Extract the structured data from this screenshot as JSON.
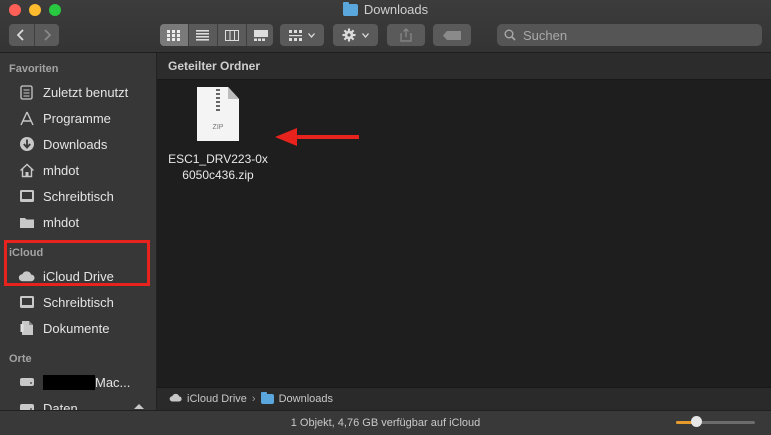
{
  "window": {
    "title": "Downloads"
  },
  "search": {
    "placeholder": "Suchen"
  },
  "sidebar": {
    "sections": [
      {
        "header": "Favoriten",
        "items": [
          {
            "label": "Zuletzt benutzt",
            "icon": "recents-icon"
          },
          {
            "label": "Programme",
            "icon": "applications-icon"
          },
          {
            "label": "Downloads",
            "icon": "downloads-icon"
          },
          {
            "label": "mhdot",
            "icon": "home-icon"
          },
          {
            "label": "Schreibtisch",
            "icon": "desktop-icon"
          },
          {
            "label": "mhdot",
            "icon": "folder-icon"
          }
        ]
      },
      {
        "header": "iCloud",
        "items": [
          {
            "label": "iCloud Drive",
            "icon": "cloud-icon"
          },
          {
            "label": "Schreibtisch",
            "icon": "desktop-icon"
          },
          {
            "label": "Dokumente",
            "icon": "documents-icon"
          }
        ]
      },
      {
        "header": "Orte",
        "items": [
          {
            "label": "Mac...",
            "icon": "disk-icon"
          },
          {
            "label": "Daten",
            "icon": "disk-icon"
          }
        ]
      }
    ]
  },
  "main": {
    "group_header": "Geteilter Ordner",
    "file": {
      "name_line1": "ESC1_DRV223-0x",
      "name_line2": "6050c436.zip",
      "type_tag": "ZIP"
    }
  },
  "pathbar": {
    "items": [
      "iCloud Drive",
      "Downloads"
    ]
  },
  "status": {
    "text": "1 Objekt, 4,76 GB verfügbar auf iCloud"
  },
  "icon_size_slider": {
    "value": 0.25
  },
  "colors": {
    "annotation_red": "#e8221d",
    "folder_blue": "#5aa7de",
    "slider_accent": "#e69b2b"
  }
}
